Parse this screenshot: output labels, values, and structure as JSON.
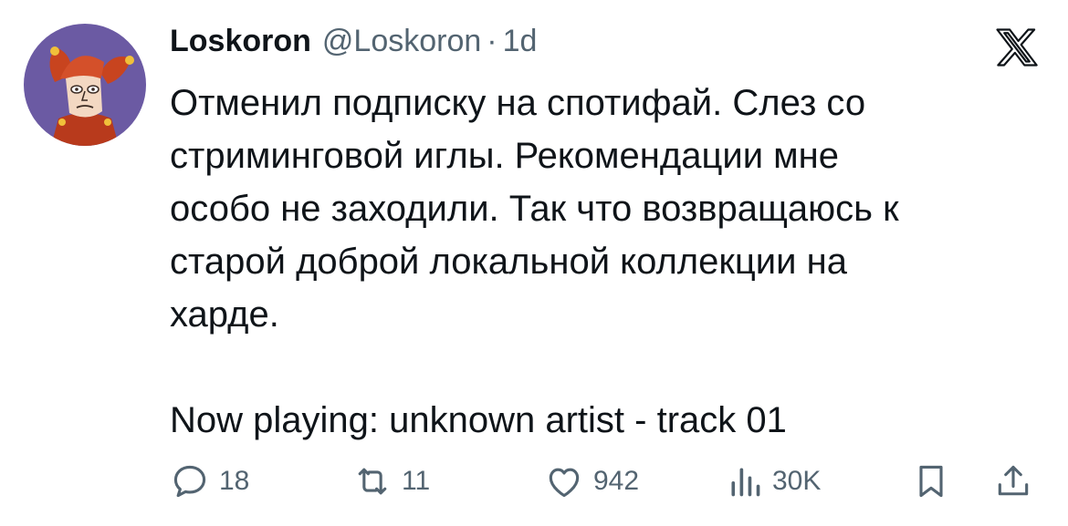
{
  "author": {
    "display_name": "Loskoron",
    "handle": "@Loskoron",
    "separator": "·",
    "time": "1d",
    "avatar": "jester-avatar"
  },
  "platform_logo": "x-logo-icon",
  "tweet": {
    "text": "Отменил подписку на спотифай. Слез со\nстриминговой иглы. Рекомендации мне\nособо не заходили. Так что возвращаюсь к\nстарой доброй локальной коллекции на\nхарде.\n\nNow playing: unknown artist - track 01"
  },
  "actions": {
    "replies": "18",
    "reposts": "11",
    "likes": "942",
    "views": "30K",
    "icons": [
      "reply-icon",
      "repost-icon",
      "like-icon",
      "views-icon",
      "bookmark-icon",
      "share-icon"
    ]
  },
  "colors": {
    "text": "#0f1419",
    "secondary": "#536471",
    "avatar_background": "#6b5aa3",
    "jester_hat": "#c8441f"
  }
}
